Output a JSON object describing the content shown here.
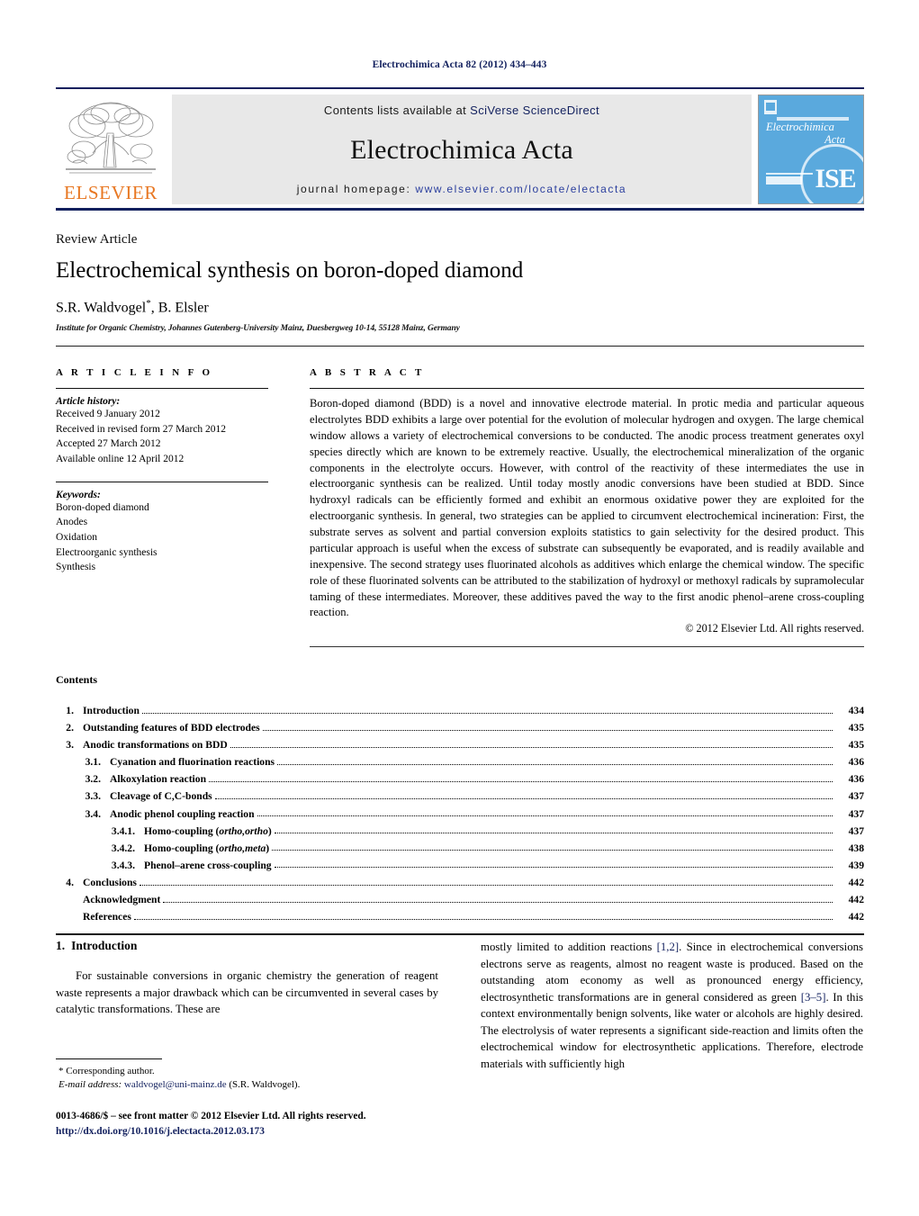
{
  "running_head": "Electrochimica Acta 82 (2012) 434–443",
  "masthead": {
    "contents_prefix": "Contents lists available at ",
    "contents_link": "SciVerse ScienceDirect",
    "journal_name": "Electrochimica Acta",
    "homepage_prefix": "journal homepage: ",
    "homepage_link": "www.elsevier.com/locate/electacta",
    "publisher_logo_text": "ELSEVIER",
    "cover": {
      "title_line1": "Electrochimica",
      "title_line2": "Acta",
      "society_mark": "ISE"
    },
    "colors": {
      "rule": "#12205e",
      "band": "#e8e8e8",
      "elsevier_orange": "#e87722",
      "cover_blue": "#5aa9dd",
      "link": "#2b3f9e"
    }
  },
  "title_block": {
    "article_type": "Review Article",
    "title": "Electrochemical synthesis on boron-doped diamond",
    "authors": "S.R. Waldvogel",
    "authors_star": "*",
    "authors_rest": ", B. Elsler",
    "affiliation": "Institute for Organic Chemistry, Johannes Gutenberg-University Mainz, Duesbergweg 10-14, 55128 Mainz, Germany"
  },
  "article_info": {
    "heading": "A R T I C L E   I N F O",
    "history_label": "Article history:",
    "history": [
      "Received 9 January 2012",
      "Received in revised form 27 March 2012",
      "Accepted 27 March 2012",
      "Available online 12 April 2012"
    ],
    "keywords_label": "Keywords:",
    "keywords": [
      "Boron-doped diamond",
      "Anodes",
      "Oxidation",
      "Electroorganic synthesis",
      "Synthesis"
    ]
  },
  "abstract": {
    "heading": "A B S T R A C T",
    "text": "Boron-doped diamond (BDD) is a novel and innovative electrode material. In protic media and particular aqueous electrolytes BDD exhibits a large over potential for the evolution of molecular hydrogen and oxygen. The large chemical window allows a variety of electrochemical conversions to be conducted. The anodic process treatment generates oxyl species directly which are known to be extremely reactive. Usually, the electrochemical mineralization of the organic components in the electrolyte occurs. However, with control of the reactivity of these intermediates the use in electroorganic synthesis can be realized. Until today mostly anodic conversions have been studied at BDD. Since hydroxyl radicals can be efficiently formed and exhibit an enormous oxidative power they are exploited for the electroorganic synthesis. In general, two strategies can be applied to circumvent electrochemical incineration: First, the substrate serves as solvent and partial conversion exploits statistics to gain selectivity for the desired product. This particular approach is useful when the excess of substrate can subsequently be evaporated, and is readily available and inexpensive. The second strategy uses fluorinated alcohols as additives which enlarge the chemical window. The specific role of these fluorinated solvents can be attributed to the stabilization of hydroxyl or methoxyl radicals by supramolecular taming of these intermediates. Moreover, these additives paved the way to the first anodic phenol–arene cross-coupling reaction.",
    "copyright": "© 2012 Elsevier Ltd. All rights reserved."
  },
  "contents": {
    "heading": "Contents",
    "entries": [
      {
        "level": 1,
        "num": "1.",
        "label": "Introduction",
        "page": "434"
      },
      {
        "level": 1,
        "num": "2.",
        "label": "Outstanding features of BDD electrodes",
        "page": "435"
      },
      {
        "level": 1,
        "num": "3.",
        "label": "Anodic transformations on BDD",
        "page": "435"
      },
      {
        "level": 2,
        "num": "3.1.",
        "label": "Cyanation and fluorination reactions",
        "page": "436"
      },
      {
        "level": 2,
        "num": "3.2.",
        "label": "Alkoxylation reaction",
        "page": "436"
      },
      {
        "level": 2,
        "num": "3.3.",
        "label": "Cleavage of C,C-bonds",
        "page": "437"
      },
      {
        "level": 2,
        "num": "3.4.",
        "label": "Anodic phenol coupling reaction",
        "page": "437"
      },
      {
        "level": 3,
        "num": "3.4.1.",
        "label": "Homo-coupling (ortho,ortho)",
        "page": "437"
      },
      {
        "level": 3,
        "num": "3.4.2.",
        "label": "Homo-coupling (ortho,meta)",
        "page": "438"
      },
      {
        "level": 3,
        "num": "3.4.3.",
        "label": "Phenol–arene cross-coupling",
        "page": "439"
      },
      {
        "level": 1,
        "num": "4.",
        "label": "Conclusions",
        "page": "442"
      },
      {
        "level": 1,
        "num": "",
        "label": "Acknowledgment",
        "page": "442"
      },
      {
        "level": 1,
        "num": "",
        "label": "References",
        "page": "442"
      }
    ]
  },
  "body": {
    "section_num": "1.",
    "section_title": "Introduction",
    "left_paragraph_a": "For sustainable conversions in organic chemistry the generation of reagent waste represents a major drawback which can be circumvented in several cases by catalytic transformations. These are",
    "right_paragraph_pre": "mostly limited to addition reactions ",
    "right_cite_1": "[1,2]",
    "right_paragraph_mid": ". Since in electrochemical conversions electrons serve as reagents, almost no reagent waste is produced. Based on the outstanding atom economy as well as pronounced energy efficiency, electrosynthetic transformations are in general considered as green ",
    "right_cite_2": "[3–5]",
    "right_paragraph_post": ". In this context environmentally benign solvents, like water or alcohols are highly desired. The electrolysis of water represents a significant side-reaction and limits often the electrochemical window for electrosynthetic applications. Therefore, electrode materials with sufficiently high"
  },
  "footnote": {
    "corresponding": "* Corresponding author.",
    "email_label": "E-mail address:",
    "email": "waldvogel@uni-mainz.de",
    "email_owner": "(S.R. Waldvogel).",
    "imprint_line1": "0013-4686/$ – see front matter © 2012 Elsevier Ltd. All rights reserved.",
    "doi": "http://dx.doi.org/10.1016/j.electacta.2012.03.173"
  }
}
